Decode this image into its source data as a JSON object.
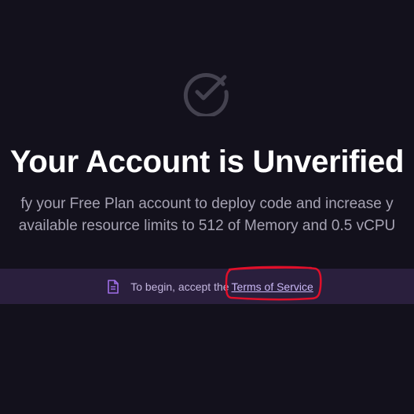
{
  "verification": {
    "icon": "check-circle-icon",
    "title": "Your Account is Unverified",
    "description_line1": "fy your Free Plan account to deploy code and increase y",
    "description_line2": "available resource limits to 512 of Memory and 0.5 vCPU"
  },
  "banner": {
    "icon": "document-icon",
    "prefix": "To begin, accept the",
    "link_label": "Terms of Service"
  },
  "colors": {
    "background": "#13111c",
    "banner_background": "#2a1f3d",
    "accent": "#a06ee8",
    "annotation": "#e0102a"
  }
}
